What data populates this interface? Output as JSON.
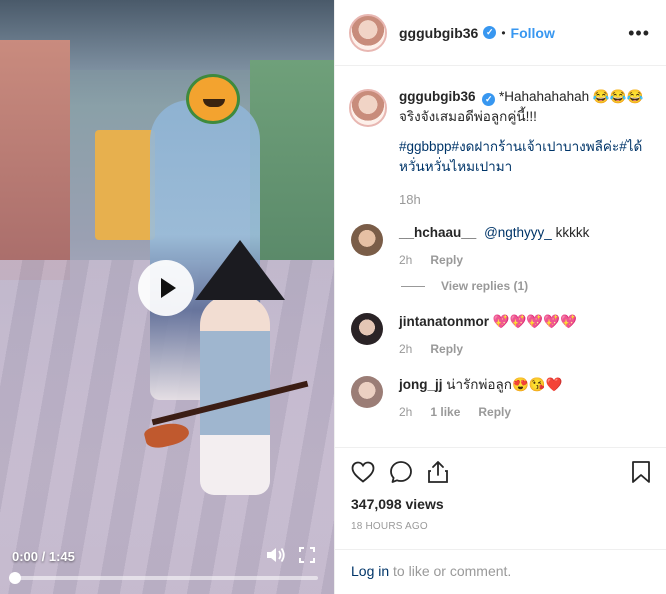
{
  "video": {
    "play_icon": "play-icon",
    "time_display": "0:00 / 1:45",
    "progress": 0,
    "volume_icon": "volume-icon",
    "fullscreen_icon": "fullscreen-icon"
  },
  "header": {
    "username": "gggubgib36",
    "verified_icon": "verified-badge-icon",
    "separator": "•",
    "follow_label": "Follow",
    "more_icon": "more-options-icon",
    "more_label": "•••"
  },
  "caption": {
    "username": "gggubgib36",
    "text": " *Hahahahahah 😂😂😂จริงจังเสมอดีพ่อลูกคู่นี้!!!",
    "hashtags": "#ggbbpp#งดฝากร้านเจ้าเปาบางพลีค่ะ#ได้หวั่นหวั่นไหมเปามา",
    "time": "18h"
  },
  "comments": [
    {
      "username": "__hchaau__",
      "mention": "@ngthyyy_",
      "text": " kkkkk",
      "time": "2h",
      "reply_label": "Reply",
      "replies_label": "View replies (1)"
    },
    {
      "username": "jintanatonmor",
      "text": " 💖💖💖💖💖",
      "time": "2h",
      "reply_label": "Reply"
    },
    {
      "username": "jong_jj",
      "text": " น่ารักพ่อลูก😍😘❤️",
      "time": "2h",
      "likes": "1 like",
      "reply_label": "Reply"
    }
  ],
  "actions": {
    "like_icon": "heart-icon",
    "comment_icon": "comment-icon",
    "share_icon": "share-icon",
    "save_icon": "bookmark-icon",
    "views": "347,098 views",
    "posted": "18 HOURS AGO"
  },
  "footer": {
    "login_link": "Log in",
    "login_text": " to like or comment."
  },
  "colors": {
    "accent": "#3897f0",
    "link": "#003569",
    "muted": "#999999"
  }
}
